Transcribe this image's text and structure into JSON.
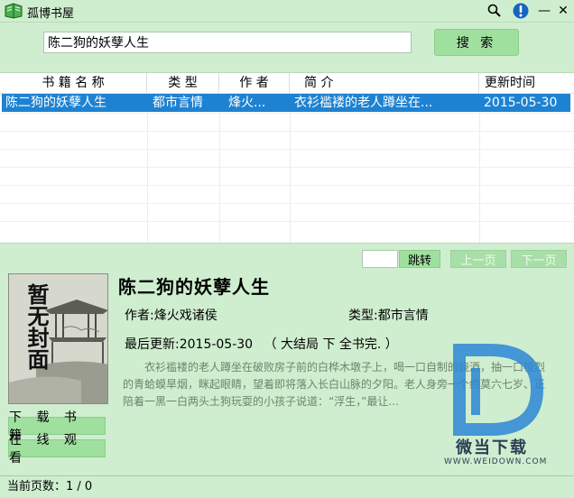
{
  "window": {
    "title": "孤博书屋"
  },
  "search": {
    "value": "陈二狗的妖孽人生",
    "button_label": "搜 索"
  },
  "table": {
    "columns": [
      "书 籍 名 称",
      "类 型",
      "作 者",
      "简 介",
      "更新时间"
    ],
    "rows": [
      {
        "name": "陈二狗的妖孽人生",
        "type": "都市言情",
        "author": "烽火...",
        "intro": "衣衫褴褛的老人蹲坐在...",
        "updated": "2015-05-30"
      }
    ]
  },
  "pagination": {
    "jump_label": "跳转",
    "prev_label": "上一页",
    "next_label": "下一页"
  },
  "book": {
    "cover_text": "暂无封面",
    "title": "陈二狗的妖孽人生",
    "author_label": "作者:",
    "author": "烽火戏诸侯",
    "type_label": "类型:",
    "type": "都市言情",
    "updated_label": "最后更新:",
    "updated": "2015-05-30",
    "status": "（ 大结局 下 全书完. ）",
    "description": "衣衫褴褛的老人蹲坐在破败房子前的白桦木墩子上，喝一口自制的烧酒，抽一口极烈的青蛤蟆旱烟，眯起眼睛，望着即将落入长白山脉的夕阳。老人身旁一个约莫六七岁、正陪着一黑一白两头土狗玩耍的小孩子说道：“浮生，”最让..."
  },
  "actions": {
    "download_label": "下 载 书 籍",
    "online_label": "在 线 观 看"
  },
  "status_bar": {
    "label": "当前页数：1 / 0"
  },
  "watermark": {
    "brand": "微当下载",
    "url": "WWW.WEIDOWN.COM"
  },
  "colors": {
    "background": "#cfeecf",
    "button": "#9fe09f",
    "selection": "#1e82d2"
  },
  "icons": [
    "book-app-icon",
    "search-icon",
    "info-icon",
    "minimize-icon",
    "close-icon"
  ]
}
